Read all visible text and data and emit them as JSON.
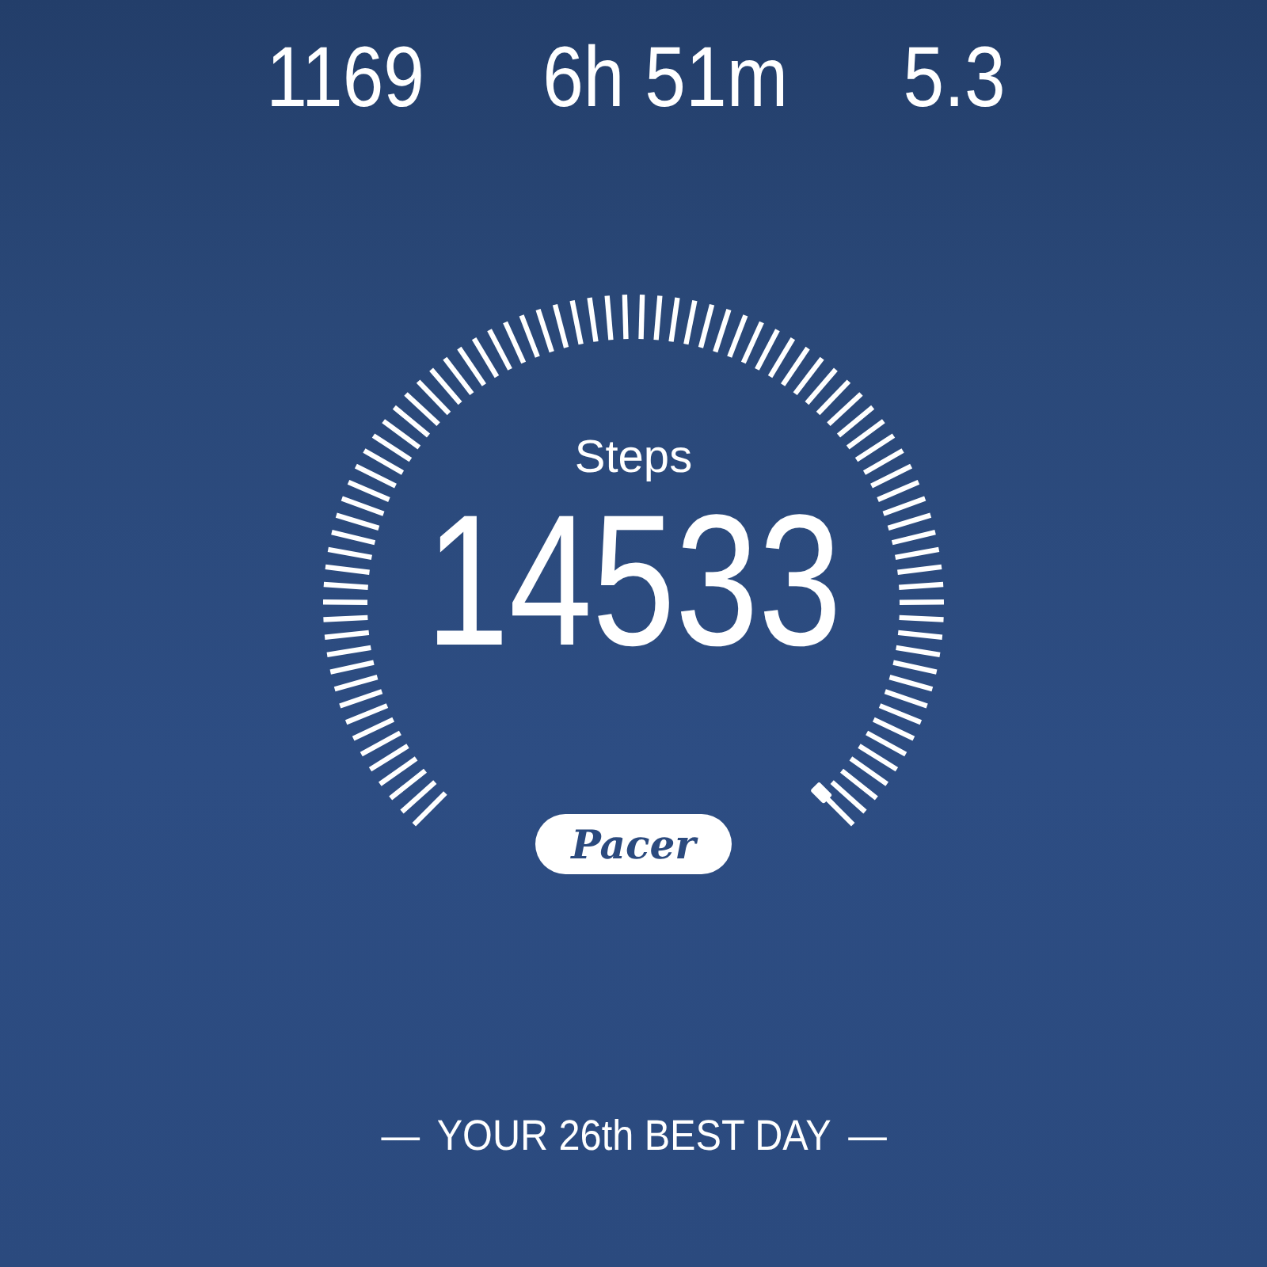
{
  "stats": [
    {
      "value": "1169"
    },
    {
      "value": "6h 51m"
    },
    {
      "value": "5.3"
    }
  ],
  "gauge": {
    "label": "Steps",
    "value": "14533"
  },
  "logo": "Pacer",
  "rank": {
    "dash_left": "—",
    "text": "YOUR 26th BEST DAY",
    "dash_right": "—"
  }
}
